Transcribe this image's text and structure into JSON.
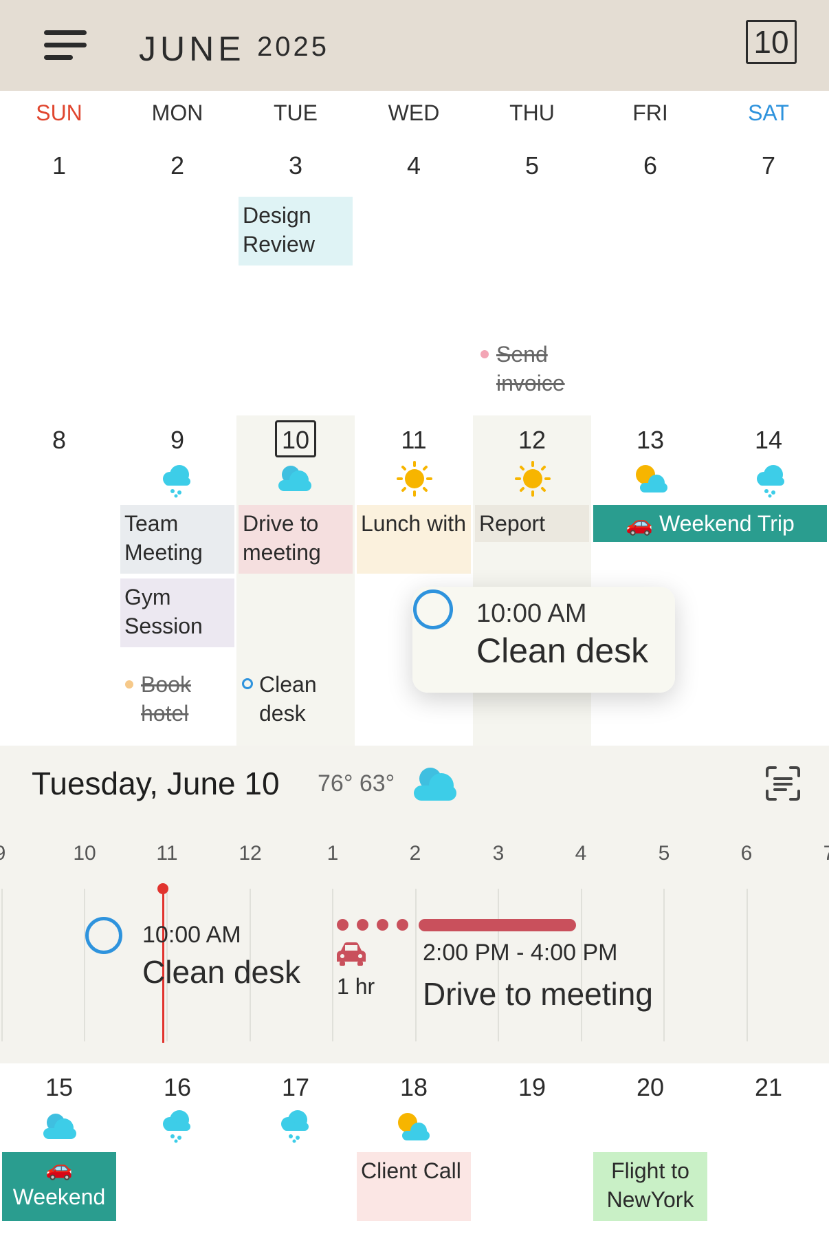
{
  "header": {
    "month": "JUNE",
    "year": "2025",
    "today_button": "10"
  },
  "weekdays": [
    "SUN",
    "MON",
    "TUE",
    "WED",
    "THU",
    "FRI",
    "SAT"
  ],
  "week1": {
    "days": [
      "1",
      "2",
      "3",
      "4",
      "5",
      "6",
      "7"
    ],
    "events": {
      "design_review": "Design Review"
    },
    "todos": {
      "send_invoice": "Send invoice"
    }
  },
  "week2": {
    "days": [
      "8",
      "9",
      "10",
      "11",
      "12",
      "13",
      "14"
    ],
    "events": {
      "team_meeting": "Team Meeting",
      "gym_session": "Gym Session",
      "drive_to_meeting": "Drive to meeting",
      "lunch_with": "Lunch with",
      "report": "Report",
      "weekend_trip": "Weekend Trip",
      "weekend_trip_emoji": "🚗"
    },
    "todos": {
      "book_hotel": "Book hotel",
      "clean_desk": "Clean desk"
    }
  },
  "popup": {
    "time": "10:00 AM",
    "title": "Clean desk"
  },
  "day_panel": {
    "date": "Tuesday, June 10",
    "temps": "76° 63°",
    "hours": [
      "9",
      "10",
      "11",
      "12",
      "1",
      "2",
      "3",
      "4",
      "5",
      "6",
      "7"
    ],
    "task": {
      "time": "10:00 AM",
      "title": "Clean desk"
    },
    "travel": {
      "duration": "1 hr"
    },
    "event": {
      "time": "2:00 PM - 4:00 PM",
      "title": "Drive to meeting"
    }
  },
  "week3": {
    "days": [
      "15",
      "16",
      "17",
      "18",
      "19",
      "20",
      "21"
    ],
    "events": {
      "weekend": "Weekend",
      "weekend_emoji": "🚗",
      "client_call": "Client Call",
      "flight": "Flight to NewYork"
    }
  },
  "colors": {
    "header_bg": "#e4ddd3",
    "sunday": "#e0462f",
    "saturday": "#2e93dd",
    "teal_event": "#2a9d8f",
    "now_line": "#e1332e",
    "drive_bar": "#c9505c"
  },
  "icons": {
    "menu": "hamburger-menu-icon",
    "weather_snow": "snow-cloud-icon",
    "weather_cloudy": "cloudy-icon",
    "weather_sunny": "sun-icon",
    "weather_partly": "partly-cloudy-icon",
    "car": "car-icon",
    "task_circle": "task-circle-icon",
    "scan": "scan-list-icon"
  }
}
